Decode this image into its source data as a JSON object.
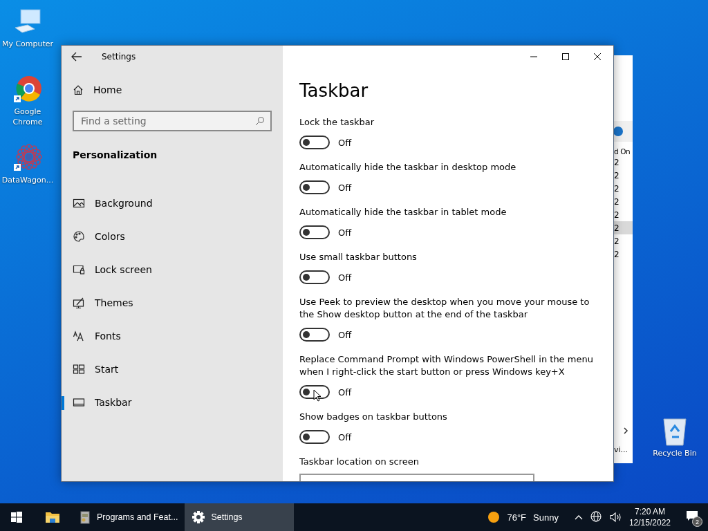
{
  "desktop_icons": [
    {
      "kind": "computer",
      "label": "My Computer",
      "shortcut": false
    },
    {
      "kind": "chrome",
      "label": "Google Chrome",
      "shortcut": true
    },
    {
      "kind": "mandala",
      "label": "DataWagon...",
      "shortcut": true
    }
  ],
  "recycle_bin": {
    "label": "Recycle Bin"
  },
  "back_window": {
    "header": "d On",
    "rows": [
      {
        "text": "2",
        "selected": false
      },
      {
        "text": "2",
        "selected": false
      },
      {
        "text": "2",
        "selected": false
      },
      {
        "text": "2",
        "selected": false
      },
      {
        "text": "2",
        "selected": false
      },
      {
        "text": "2",
        "selected": true
      },
      {
        "text": "2",
        "selected": false
      },
      {
        "text": "2",
        "selected": false
      }
    ],
    "status": "vi..."
  },
  "window": {
    "title": "Settings"
  },
  "sidebar": {
    "home": "Home",
    "search": {
      "placeholder": "Find a setting"
    },
    "section": "Personalization",
    "items": [
      {
        "kind": "background",
        "label": "Background",
        "selected": false
      },
      {
        "kind": "colors",
        "label": "Colors",
        "selected": false
      },
      {
        "kind": "lock",
        "label": "Lock screen",
        "selected": false
      },
      {
        "kind": "themes",
        "label": "Themes",
        "selected": false
      },
      {
        "kind": "fonts",
        "label": "Fonts",
        "selected": false
      },
      {
        "kind": "start",
        "label": "Start",
        "selected": false
      },
      {
        "kind": "taskbar",
        "label": "Taskbar",
        "selected": true
      }
    ]
  },
  "page": {
    "title": "Taskbar",
    "settings": [
      {
        "label": "Lock the taskbar",
        "on": false,
        "state": "Off"
      },
      {
        "label": "Automatically hide the taskbar in desktop mode",
        "on": false,
        "state": "Off"
      },
      {
        "label": "Automatically hide the taskbar in tablet mode",
        "on": false,
        "state": "Off"
      },
      {
        "label": "Use small taskbar buttons",
        "on": false,
        "state": "Off"
      },
      {
        "label": "Use Peek to preview the desktop when you move your mouse to the Show desktop button at the end of the taskbar",
        "on": false,
        "state": "Off"
      },
      {
        "label": "Replace Command Prompt with Windows PowerShell in the menu when I right-click the start button or press Windows key+X",
        "on": false,
        "state": "Off"
      },
      {
        "label": "Show badges on taskbar buttons",
        "on": false,
        "state": "Off"
      }
    ],
    "location_label": "Taskbar location on screen"
  },
  "taskbar": {
    "apps": [
      {
        "kind": "explorer",
        "selected": false
      },
      {
        "kind": "programs",
        "label": "Programs and Feat...",
        "selected": false
      },
      {
        "kind": "settings",
        "label": "Settings",
        "selected": true
      }
    ],
    "weather": {
      "temp": "76°F",
      "condition": "Sunny"
    },
    "time": "7:20 AM",
    "date": "12/15/2022",
    "notifications": "2"
  }
}
